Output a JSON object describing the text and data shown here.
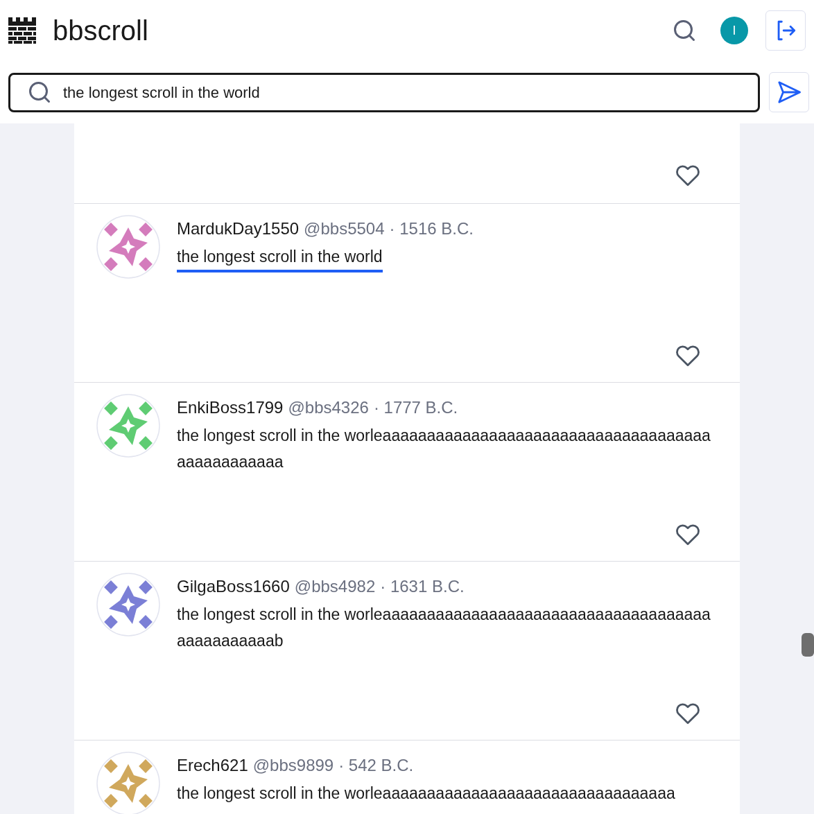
{
  "header": {
    "brand": "bbscroll",
    "avatar_initial": "I"
  },
  "search": {
    "value": "the longest scroll in the world"
  },
  "posts": [
    {
      "kind": "cut_off"
    },
    {
      "name": "MardukDay1550",
      "handle": "@bbs5504",
      "date": "· 1516 B.C.",
      "text": "the longest scroll in the world",
      "highlighted": true,
      "color": "#d47cbc"
    },
    {
      "name": "EnkiBoss1799",
      "handle": "@bbs4326",
      "date": "· 1777 B.C.",
      "text": "the longest scroll in the worleaaaaaaaaaaaaaaaaaaaaaaaaaaaaaaaaaaaaaaaaaaaaaaaaa",
      "highlighted": false,
      "color": "#5fcc73"
    },
    {
      "name": "GilgaBoss1660",
      "handle": "@bbs4982",
      "date": "· 1631 B.C.",
      "text": "the longest scroll in the worleaaaaaaaaaaaaaaaaaaaaaaaaaaaaaaaaaaaaaaaaaaaaaaaab",
      "highlighted": false,
      "color": "#7b7fd6"
    },
    {
      "name": "Erech621",
      "handle": "@bbs9899",
      "date": "· 542 B.C.",
      "text": "the longest scroll in the worleaaaaaaaaaaaaaaaaaaaaaaaaaaaaaaaaa",
      "highlighted": false,
      "color": "#d0a85c"
    }
  ]
}
